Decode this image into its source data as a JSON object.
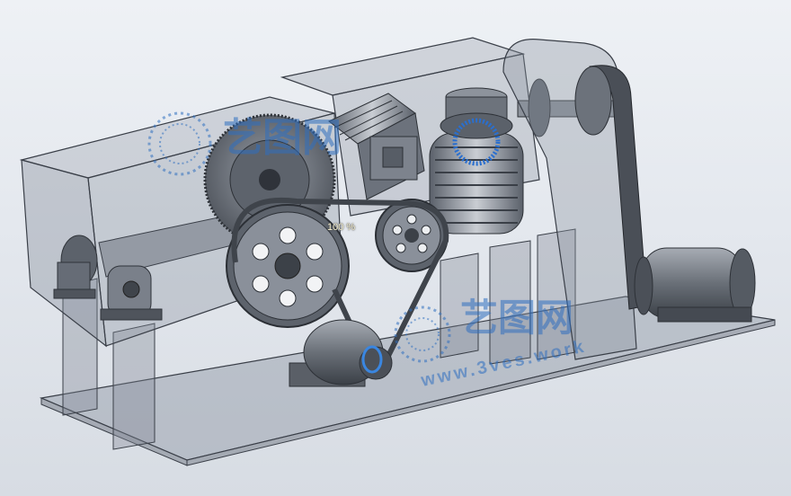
{
  "viewport": {
    "zoom_text": "100 %",
    "background_color": "#e6e9ee",
    "part_color": "#5c616b",
    "housing_color": "#7c8492"
  },
  "watermark": {
    "brand_text": "艺图网",
    "url_text": "www.3ves.work",
    "color": "#2f6fc0"
  }
}
